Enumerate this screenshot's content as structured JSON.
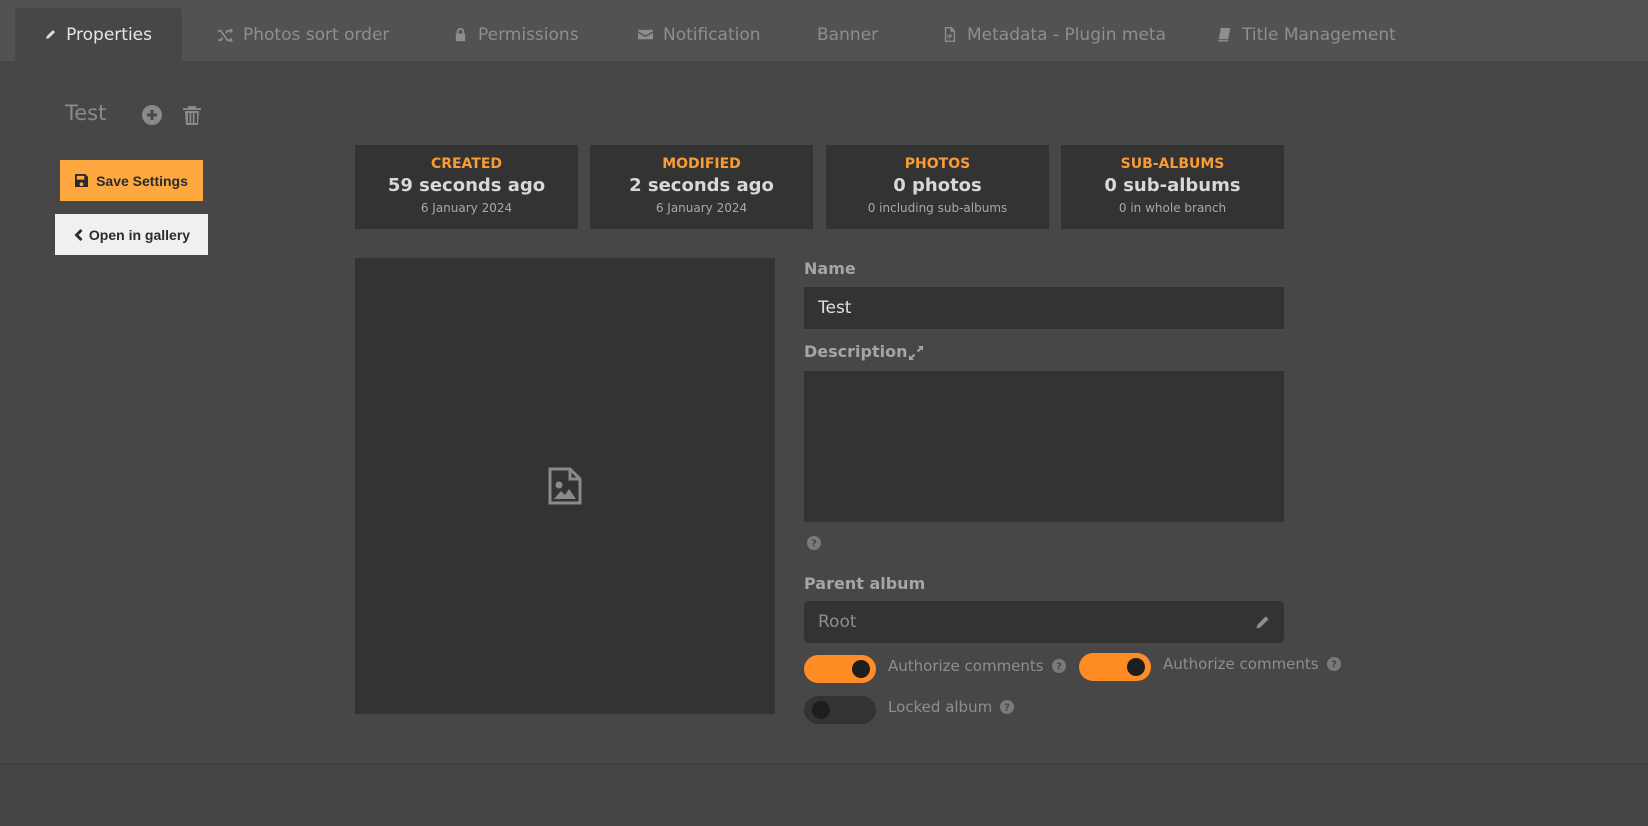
{
  "tabs": [
    {
      "label": "Properties",
      "icon": "pencil-icon",
      "active": true
    },
    {
      "label": "Photos sort order",
      "icon": "shuffle-icon"
    },
    {
      "label": "Permissions",
      "icon": "lock-icon"
    },
    {
      "label": "Notification",
      "icon": "envelope-icon"
    },
    {
      "label": "Banner",
      "icon": ""
    },
    {
      "label": "Metadata - Plugin meta",
      "icon": "code-file-icon"
    },
    {
      "label": "Title Management",
      "icon": "book-icon"
    }
  ],
  "album": {
    "title": "Test"
  },
  "actions": {
    "save_label": "Save Settings",
    "open_label": "Open in gallery"
  },
  "stats": [
    {
      "label": "CREATED",
      "value": "59 seconds ago",
      "sub": "6 January 2024"
    },
    {
      "label": "MODIFIED",
      "value": "2 seconds ago",
      "sub": "6 January 2024"
    },
    {
      "label": "PHOTOS",
      "value": "0 photos",
      "sub": "0 including sub-albums"
    },
    {
      "label": "SUB-ALBUMS",
      "value": "0 sub-albums",
      "sub": "0 in whole branch"
    }
  ],
  "form": {
    "name_label": "Name",
    "name_value": "Test",
    "description_label": "Description",
    "description_value": "",
    "parent_label": "Parent album",
    "parent_value": "Root"
  },
  "toggles": [
    {
      "label": "Authorize comments",
      "on": true
    },
    {
      "label": "Authorize comments",
      "on": true
    },
    {
      "label": "Locked album",
      "on": false
    }
  ],
  "colors": {
    "accent": "#ffa83f",
    "toggle_on": "#ff8c24",
    "stat_label": "#f99c33",
    "background": "#474747",
    "panel": "#333333"
  }
}
